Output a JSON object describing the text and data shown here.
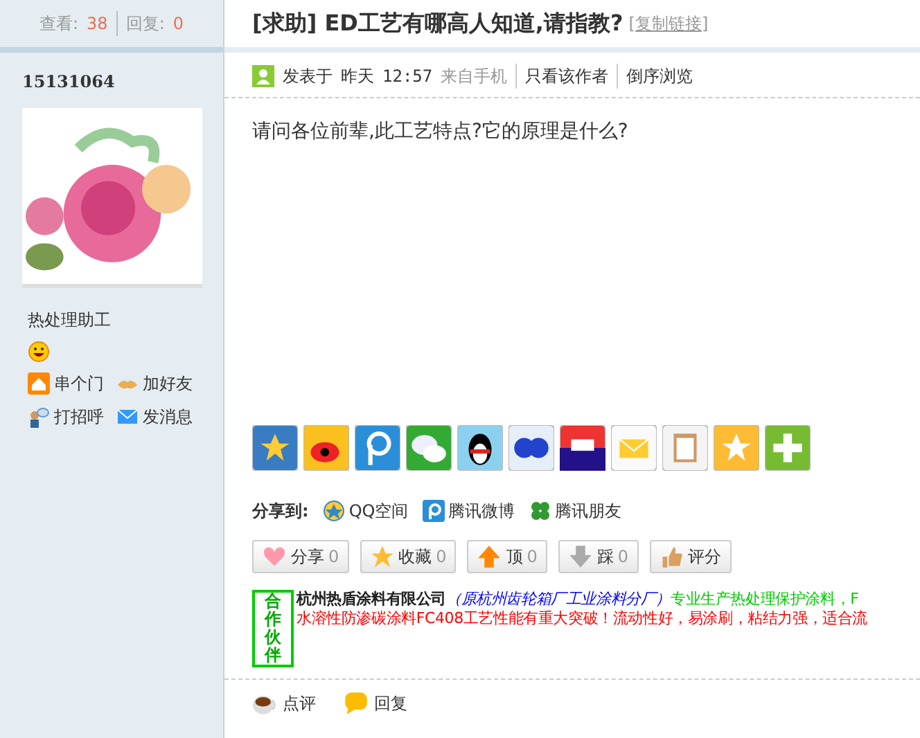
{
  "stats": {
    "views_label": "查看:",
    "views": "38",
    "replies_label": "回复:",
    "replies": "0"
  },
  "thread": {
    "title": "[求助] ED工艺有哪高人知道,请指教?",
    "copy_link": "[复制链接]"
  },
  "author": {
    "name": "15131064",
    "rank": "热处理助工",
    "actions": [
      {
        "label": "串个门",
        "kind": "home"
      },
      {
        "label": "加好友",
        "kind": "friend"
      },
      {
        "label": "打招呼",
        "kind": "greet"
      },
      {
        "label": "发消息",
        "kind": "message"
      }
    ]
  },
  "post": {
    "posted": "发表于",
    "day": "昨天",
    "time": "12:57",
    "source": "来自手机",
    "links": [
      "只看该作者",
      "倒序浏览"
    ],
    "body": "请问各位前辈,此工艺特点?它的原理是什么?"
  },
  "share_to": {
    "label": "分享到:",
    "targets": [
      {
        "label": "QQ空间",
        "kind": "qzone"
      },
      {
        "label": "腾讯微博",
        "kind": "weibo"
      },
      {
        "label": "腾讯朋友",
        "kind": "friends"
      }
    ]
  },
  "buttons": [
    {
      "label": "分享",
      "count": "0",
      "kind": "heart"
    },
    {
      "label": "收藏",
      "count": "0",
      "kind": "star"
    },
    {
      "label": "顶",
      "count": "0",
      "kind": "up"
    },
    {
      "label": "踩",
      "count": "0",
      "kind": "down"
    },
    {
      "label": "评分",
      "kind": "thumb"
    }
  ],
  "partner": {
    "badge": "合作伙伴",
    "company": "杭州热盾涂料有限公司",
    "former": "（原杭州齿轮箱厂工业涂料分厂）",
    "slogan": "专业生产热处理保护涂料，F",
    "news": "水溶性防渗碳涂料FC408工艺性能有重大突破！流动性好，易涂刷，粘结力强，适合流"
  },
  "footer": [
    {
      "label": "点评",
      "kind": "cup"
    },
    {
      "label": "回复",
      "kind": "bubble"
    }
  ]
}
